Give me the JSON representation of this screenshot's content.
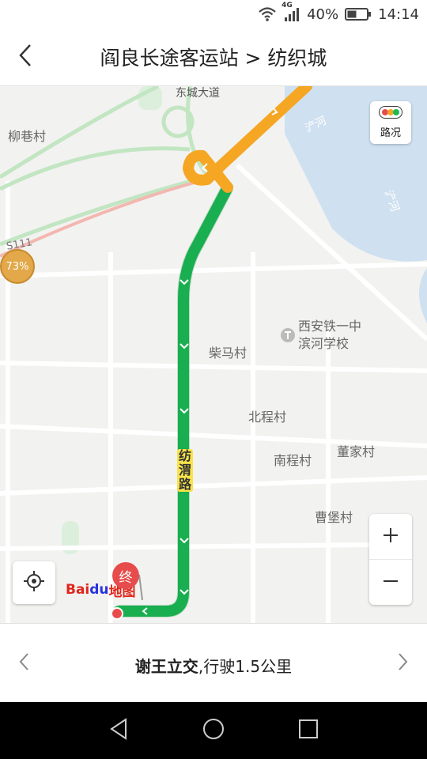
{
  "status_bar": {
    "network": "4G",
    "battery": "40%",
    "time": "14:14"
  },
  "header": {
    "title": "阎良长途客运站 > 纺织城"
  },
  "map": {
    "labels": {
      "liuxiang": "柳巷村",
      "chengdadao": "东城大道",
      "river1": "浐河",
      "river2": "浐河",
      "school_line1": "西安铁一中",
      "school_line2": "滨河学校",
      "chaima": "柴马村",
      "beicheng": "北程村",
      "dongjia": "董家村",
      "nancheng": "南程村",
      "caobao": "曹堡村",
      "road_marker": "S111"
    },
    "road_name": "纺渭路",
    "traffic_button": "路况",
    "end_marker": "终",
    "progress": "73%",
    "logo_part1": "Bai",
    "logo_part2": "du",
    "logo_part3": "地图"
  },
  "instruction": {
    "road": "谢王立交",
    "detail": ",行驶1.5公里"
  },
  "colors": {
    "route_green": "#1db954",
    "route_orange": "#f5a623",
    "river": "#cfe0f0",
    "end_red": "#e74c4c"
  }
}
